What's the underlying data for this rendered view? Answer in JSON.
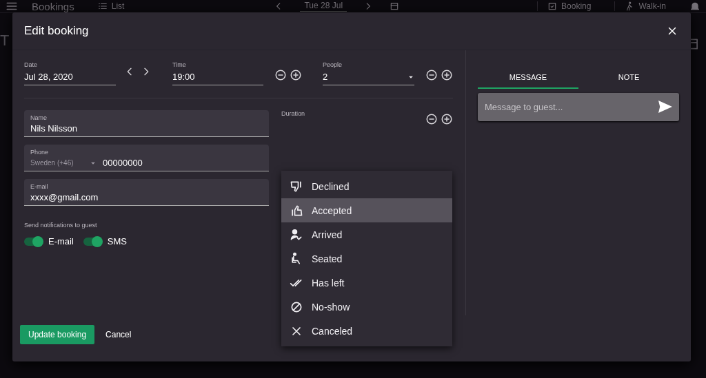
{
  "background": {
    "menu_title": "Bookings",
    "view": "List",
    "date": "Tue 28 Jul",
    "actions": [
      "Booking",
      "Walk-in"
    ],
    "page_title": "T"
  },
  "dialog": {
    "title": "Edit booking",
    "date": {
      "label": "Date",
      "value": "Jul 28, 2020"
    },
    "time": {
      "label": "Time",
      "value": "19:00"
    },
    "people": {
      "label": "People",
      "value": "2"
    },
    "name": {
      "label": "Name",
      "value": "Nils Nilsson"
    },
    "phone": {
      "label": "Phone",
      "country": "Sweden (+46)",
      "value": "00000000"
    },
    "email": {
      "label": "E-mail",
      "value": "xxxx@gmail.com"
    },
    "notifications": {
      "label": "Send notifications to guest",
      "toggles": [
        {
          "label": "E-mail",
          "on": true
        },
        {
          "label": "SMS",
          "on": true
        }
      ]
    },
    "duration": {
      "label": "Duration"
    },
    "status_menu": [
      {
        "kind": "declined",
        "label": "Declined",
        "selected": false
      },
      {
        "kind": "accepted",
        "label": "Accepted",
        "selected": true
      },
      {
        "kind": "arrived",
        "label": "Arrived",
        "selected": false
      },
      {
        "kind": "seated",
        "label": "Seated",
        "selected": false
      },
      {
        "kind": "left",
        "label": "Has left",
        "selected": false
      },
      {
        "kind": "noshow",
        "label": "No-show",
        "selected": false
      },
      {
        "kind": "canceled",
        "label": "Canceled",
        "selected": false
      }
    ],
    "tabs": [
      {
        "label": "MESSAGE",
        "selected": true
      },
      {
        "label": "NOTE",
        "selected": false
      }
    ],
    "message": {
      "placeholder": "Message to guest..."
    },
    "buttons": {
      "primary": "Update booking",
      "secondary": "Cancel"
    }
  }
}
